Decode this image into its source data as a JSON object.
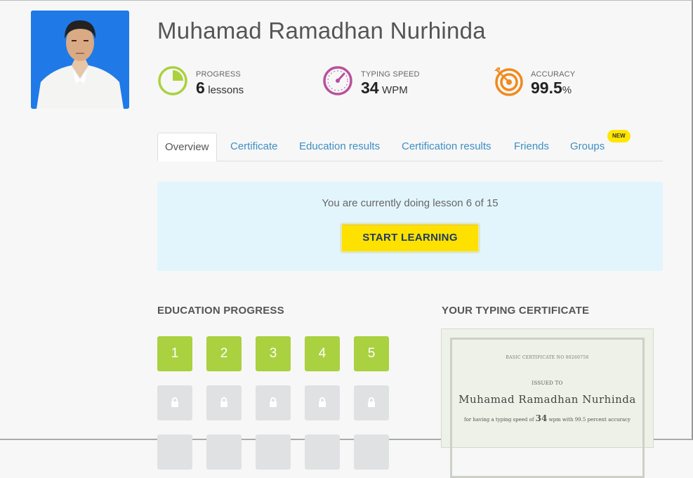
{
  "profile": {
    "name": "Muhamad Ramadhan Nurhinda"
  },
  "stats": {
    "progress": {
      "label": "PROGRESS",
      "value": "6",
      "unit": "lessons",
      "icon": "pie-progress-icon",
      "color": "#aad13f"
    },
    "speed": {
      "label": "TYPING SPEED",
      "value": "34",
      "unit": "WPM",
      "icon": "speedometer-icon",
      "color": "#b9509c"
    },
    "accuracy": {
      "label": "ACCURACY",
      "value": "99.5",
      "unit": "%",
      "icon": "target-icon",
      "color": "#f08a1c"
    }
  },
  "tabs": [
    {
      "label": "Overview"
    },
    {
      "label": "Certificate"
    },
    {
      "label": "Education results"
    },
    {
      "label": "Certification results"
    },
    {
      "label": "Friends"
    },
    {
      "label": "Groups"
    }
  ],
  "tab_badge": "NEW",
  "banner": {
    "message": "You are currently doing lesson 6 of 15",
    "button_label": "START LEARNING"
  },
  "education": {
    "title": "EDUCATION PROGRESS",
    "completed_lessons": [
      "1",
      "2",
      "3",
      "4",
      "5"
    ],
    "accent": "#aad13f"
  },
  "certificate": {
    "title": "YOUR TYPING CERTIFICATE",
    "number": "BASIC CERTIFICATE NO 00260756",
    "issued_to": "ISSUED TO",
    "name": "Muhamad Ramadhan Nurhinda",
    "desc_prefix": "for having a typing speed of",
    "speed": "34",
    "desc_suffix": "wpm with 99.5 percent accuracy"
  }
}
